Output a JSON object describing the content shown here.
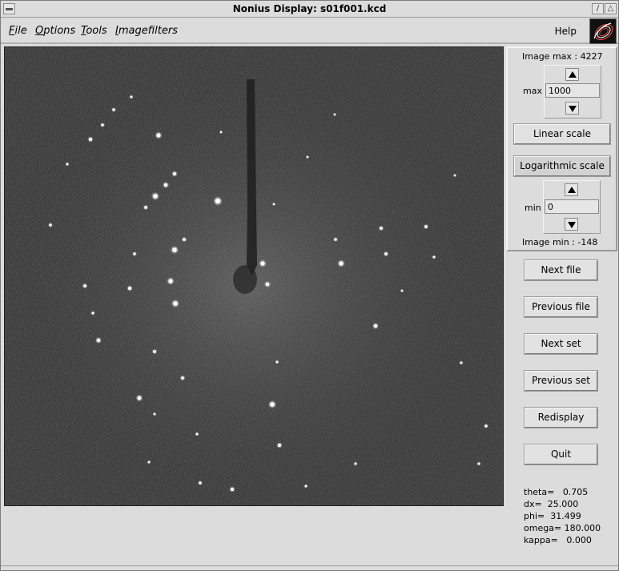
{
  "window": {
    "title": "Nonius Display: s01f001.kcd",
    "sys_button": "",
    "minimize_glyph": "/",
    "maximize_glyph": "△"
  },
  "menu": {
    "items": [
      {
        "first": "F",
        "rest": "ile"
      },
      {
        "first": "O",
        "rest": "ptions"
      },
      {
        "first": "T",
        "rest": "ools"
      },
      {
        "first": "I",
        "rest": "magefilters"
      }
    ],
    "help": "Help",
    "logo_icon": "nonius-logo-icon"
  },
  "scale": {
    "image_max_label": "Image max : 4227",
    "max_label": "max",
    "max_value": "1000",
    "linear_button": "Linear scale",
    "log_button": "Logarithmic scale",
    "min_label": "min",
    "min_value": "0",
    "image_min_label": "Image min : -148"
  },
  "buttons": {
    "next_file": "Next file",
    "previous_file": "Previous file",
    "next_set": "Next set",
    "previous_set": "Previous set",
    "redisplay": "Redisplay",
    "quit": "Quit"
  },
  "info": {
    "theta": "theta=   0.705",
    "dx": "dx=  25.000",
    "phi": "phi=  31.499",
    "omega": "omega= 180.000",
    "kappa": "kappa=   0.000"
  },
  "colors": {
    "background": "#dcdcdc",
    "image_bg": "#3f3f3f",
    "spot": "#ffffff"
  }
}
